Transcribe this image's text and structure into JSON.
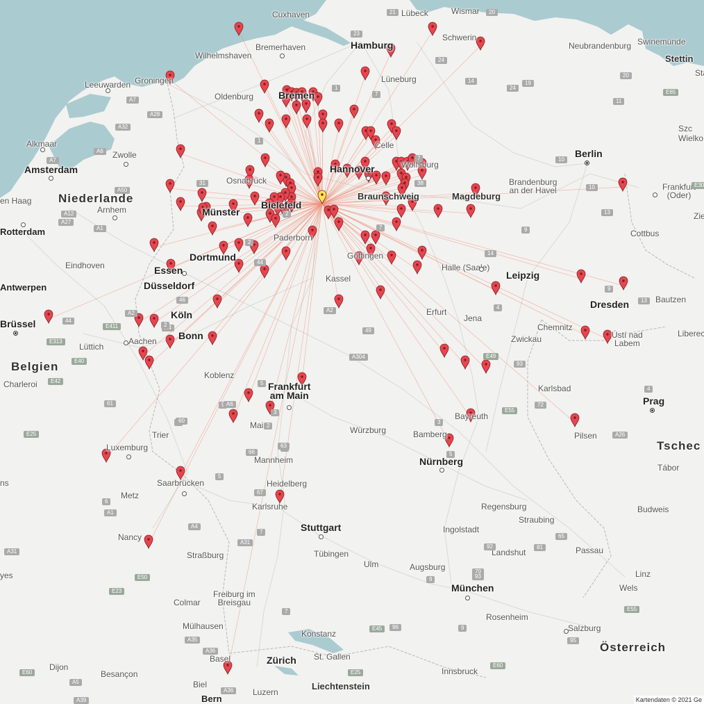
{
  "map": {
    "attribution": "Kartendaten © 2021 Ge",
    "colors": {
      "land": "#f2f2f0",
      "water": "#aacbd0",
      "marker": "#e8454f",
      "marker_selected": "#ffe34d",
      "connection_line": "#f0907a"
    },
    "labels": {
      "countries": [
        {
          "id": "niederlande",
          "text": "Niederlande"
        },
        {
          "id": "belgien",
          "text": "Belgien"
        },
        {
          "id": "tschech",
          "text": "Tschec"
        },
        {
          "id": "oesterreich",
          "text": "Österreich"
        }
      ],
      "cities": [
        {
          "id": "hamburg",
          "text": "Hamburg"
        },
        {
          "id": "berlin",
          "text": "Berlin"
        },
        {
          "id": "bremen",
          "text": "Bremen"
        },
        {
          "id": "hannover",
          "text": "Hannover"
        },
        {
          "id": "bielefeld",
          "text": "Bielefeld"
        },
        {
          "id": "muenster",
          "text": "Münster"
        },
        {
          "id": "dortmund",
          "text": "Dortmund"
        },
        {
          "id": "essen",
          "text": "Essen"
        },
        {
          "id": "duesseldorf",
          "text": "Düsseldorf"
        },
        {
          "id": "koeln",
          "text": "Köln"
        },
        {
          "id": "bonn",
          "text": "Bonn"
        },
        {
          "id": "frankfurt",
          "text": "Frankfurt\nam Main"
        },
        {
          "id": "leipzig",
          "text": "Leipzig"
        },
        {
          "id": "dresden",
          "text": "Dresden"
        },
        {
          "id": "nuernberg",
          "text": "Nürnberg"
        },
        {
          "id": "stuttgart",
          "text": "Stuttgart"
        },
        {
          "id": "muenchen",
          "text": "München"
        },
        {
          "id": "prag",
          "text": "Prag"
        },
        {
          "id": "zuerich",
          "text": "Zürich"
        },
        {
          "id": "amsterdam",
          "text": "Amsterdam"
        },
        {
          "id": "bruessel",
          "text": "Brüssel"
        },
        {
          "id": "braunschweig",
          "text": "Braunschweig"
        },
        {
          "id": "magdeburg",
          "text": "Magdeburg"
        },
        {
          "id": "stettin",
          "text": "Stettin"
        }
      ],
      "towns": [
        {
          "id": "cuxhaven",
          "text": "Cuxhaven"
        },
        {
          "id": "luebeck",
          "text": "Lübeck"
        },
        {
          "id": "wismar",
          "text": "Wismar"
        },
        {
          "id": "swinemuende",
          "text": "Swinemünde"
        },
        {
          "id": "schwerin",
          "text": "Schwerin"
        },
        {
          "id": "wilhelmshaven",
          "text": "Wilhelmshaven"
        },
        {
          "id": "bremerhaven",
          "text": "Bremerhaven"
        },
        {
          "id": "neubrandenburg",
          "text": "Neubrandenburg"
        },
        {
          "id": "leeuwarden",
          "text": "Leeuwarden"
        },
        {
          "id": "groningen",
          "text": "Groningen"
        },
        {
          "id": "oldenburg",
          "text": "Oldenburg"
        },
        {
          "id": "lueneburg",
          "text": "Lüneburg"
        },
        {
          "id": "alkmaar",
          "text": "Alkmaar"
        },
        {
          "id": "zwolle",
          "text": "Zwolle"
        },
        {
          "id": "celle",
          "text": "Celle"
        },
        {
          "id": "wolfsburg",
          "text": "Wolfsburg"
        },
        {
          "id": "osnabrueck",
          "text": "Osnabrück"
        },
        {
          "id": "brandenburg",
          "text": "Brandenburg\nan der Havel"
        },
        {
          "id": "frankfurt_oder",
          "text": "Frankfurt\n(Oder)"
        },
        {
          "id": "den_haag",
          "text": "en Haag"
        },
        {
          "id": "arnhem",
          "text": "Arnhem"
        },
        {
          "id": "rotterdam",
          "text": "Rotterdam"
        },
        {
          "id": "paderborn",
          "text": "Paderborn"
        },
        {
          "id": "cottbus",
          "text": "Cottbus"
        },
        {
          "id": "goettingen",
          "text": "Göttingen"
        },
        {
          "id": "halle",
          "text": "Halle (Saale)"
        },
        {
          "id": "eindhoven",
          "text": "Eindhoven"
        },
        {
          "id": "antwerpen",
          "text": "Antwerpen"
        },
        {
          "id": "kassel",
          "text": "Kassel"
        },
        {
          "id": "bautzen",
          "text": "Bautzen"
        },
        {
          "id": "erfurt",
          "text": "Erfurt"
        },
        {
          "id": "jena",
          "text": "Jena"
        },
        {
          "id": "chemnitz",
          "text": "Chemnitz"
        },
        {
          "id": "usti",
          "text": "Ústí nad\nLabem"
        },
        {
          "id": "liberec",
          "text": "Liberec"
        },
        {
          "id": "luettich",
          "text": "Lüttich"
        },
        {
          "id": "aachen",
          "text": "Aachen"
        },
        {
          "id": "zwickau",
          "text": "Zwickau"
        },
        {
          "id": "charleroi",
          "text": "Charleroi"
        },
        {
          "id": "koblenz",
          "text": "Koblenz"
        },
        {
          "id": "karlsbad",
          "text": "Karlsbad"
        },
        {
          "id": "bayreuth",
          "text": "Bayreuth"
        },
        {
          "id": "mainz",
          "text": "Mainz"
        },
        {
          "id": "wuerzburg",
          "text": "Würzburg"
        },
        {
          "id": "trier",
          "text": "Trier"
        },
        {
          "id": "bamberg",
          "text": "Bamberg"
        },
        {
          "id": "pilsen",
          "text": "Pilsen"
        },
        {
          "id": "luxemburg",
          "text": "Luxemburg"
        },
        {
          "id": "mannheim",
          "text": "Mannheim"
        },
        {
          "id": "tabor",
          "text": "Tábor"
        },
        {
          "id": "heidelberg",
          "text": "Heidelberg"
        },
        {
          "id": "saarbruecken",
          "text": "Saarbrücken"
        },
        {
          "id": "metz",
          "text": "Metz"
        },
        {
          "id": "regensburg",
          "text": "Regensburg"
        },
        {
          "id": "karlsruhe",
          "text": "Karlsruhe"
        },
        {
          "id": "budweis",
          "text": "Budweis"
        },
        {
          "id": "straubing",
          "text": "Straubing"
        },
        {
          "id": "ingolstadt",
          "text": "Ingolstadt"
        },
        {
          "id": "nancy",
          "text": "Nancy"
        },
        {
          "id": "landshut",
          "text": "Landshut"
        },
        {
          "id": "passau",
          "text": "Passau"
        },
        {
          "id": "tuebingen",
          "text": "Tübingen"
        },
        {
          "id": "strassburg",
          "text": "Straßburg"
        },
        {
          "id": "ulm",
          "text": "Ulm"
        },
        {
          "id": "augsburg",
          "text": "Augsburg"
        },
        {
          "id": "linz",
          "text": "Linz"
        },
        {
          "id": "wels",
          "text": "Wels"
        },
        {
          "id": "colmar",
          "text": "Colmar"
        },
        {
          "id": "freiburg",
          "text": "Freiburg im\nBreisgau"
        },
        {
          "id": "rosenheim",
          "text": "Rosenheim"
        },
        {
          "id": "muelhausen",
          "text": "Mülhausen"
        },
        {
          "id": "salzburg",
          "text": "Salzburg"
        },
        {
          "id": "konstanz",
          "text": "Konstanz"
        },
        {
          "id": "basel",
          "text": "Basel"
        },
        {
          "id": "st_gallen",
          "text": "St. Gallen"
        },
        {
          "id": "dijon",
          "text": "Dijon"
        },
        {
          "id": "besancon",
          "text": "Besançon"
        },
        {
          "id": "innsbruck",
          "text": "Innsbruck"
        },
        {
          "id": "biel",
          "text": "Biel"
        },
        {
          "id": "luzern",
          "text": "Luzern"
        },
        {
          "id": "bern",
          "text": "Bern"
        },
        {
          "id": "liechtenstein",
          "text": "Liechtenstein"
        },
        {
          "id": "ns",
          "text": "ns"
        },
        {
          "id": "yes",
          "text": "yes"
        },
        {
          "id": "sta",
          "text": "Sta"
        },
        {
          "id": "szc",
          "text": "Szc\nWielko"
        },
        {
          "id": "zie",
          "text": "Zie"
        }
      ]
    },
    "road_shields": [
      "21",
      "20",
      "1",
      "23",
      "24",
      "14",
      "7",
      "24",
      "19",
      "20",
      "11",
      "1",
      "A7",
      "A28",
      "A32",
      "A6",
      "A7",
      "A50",
      "A12",
      "A27",
      "A1",
      "E65",
      "2",
      "2",
      "31",
      "7",
      "10",
      "9",
      "A2",
      "10",
      "13",
      "E30",
      "14",
      "44",
      "46",
      "38",
      "7",
      "1",
      "A4",
      "2",
      "5",
      "2",
      "44",
      "E313",
      "E40",
      "E42",
      "E411",
      "A2",
      "49",
      "4",
      "9",
      "13",
      "4",
      "E55",
      "93",
      "72",
      "E49",
      "9",
      "61",
      "E25",
      "A304",
      "7",
      "5",
      "3",
      "60",
      "1",
      "66",
      "63",
      "67",
      "65",
      "3",
      "70",
      "9",
      "5",
      "6",
      "A1",
      "A4",
      "A31",
      "A26",
      "E50",
      "E23",
      "A31",
      "A35",
      "A36",
      "A5",
      "A39",
      "A36",
      "E25",
      "E60",
      "E45",
      "96",
      "7",
      "81",
      "92",
      "93",
      "9",
      "95",
      "E55",
      "E60",
      "A6",
      "4"
    ],
    "markers": {
      "selected": {
        "label": "Hannover-Langenhagen"
      },
      "count": 156
    }
  }
}
